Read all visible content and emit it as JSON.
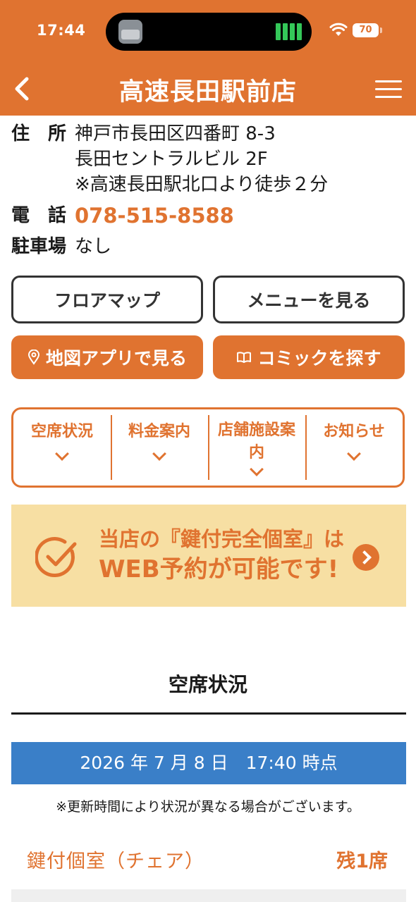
{
  "status": {
    "time": "17:44",
    "battery": "70"
  },
  "nav": {
    "title": "高速長田駅前店"
  },
  "info": {
    "address_label": "住　所",
    "address_lines": [
      "神戸市長田区四番町 8-3",
      "長田セントラルビル 2F",
      "※高速長田駅北口より徒歩２分"
    ],
    "phone_label": "電　話",
    "phone": "078-515-8588",
    "parking_label": "駐車場",
    "parking": "なし"
  },
  "buttons": {
    "floor_map": "フロアマップ",
    "menu": "メニューを見る",
    "map_app": "地図アプリで見る",
    "comic_search": "コミックを探す"
  },
  "tabs": [
    {
      "label": "空席状況"
    },
    {
      "label": "料金案内"
    },
    {
      "label": "店舗施設案内"
    },
    {
      "label": "お知らせ"
    }
  ],
  "banner": {
    "line1": "当店の『鍵付完全個室』は",
    "line2": "WEB予約が可能です!"
  },
  "availability": {
    "title": "空席状況",
    "timestamp": "2026 年 7 月 8 日　17:40 時点",
    "note": "※更新時間により状況が異なる場合がございます。",
    "seat_type": "鍵付個室（チェア）",
    "seats_left": "残1席"
  },
  "colors": {
    "brand_orange": "#e07330",
    "date_blue": "#3a7fc8",
    "banner_bg": "#f7dfa3"
  },
  "icons": [
    "back-icon",
    "hamburger-icon",
    "map-pin-icon",
    "book-icon",
    "chevron-down-icon",
    "check-circle-icon",
    "arrow-right-icon",
    "wifi-icon"
  ]
}
